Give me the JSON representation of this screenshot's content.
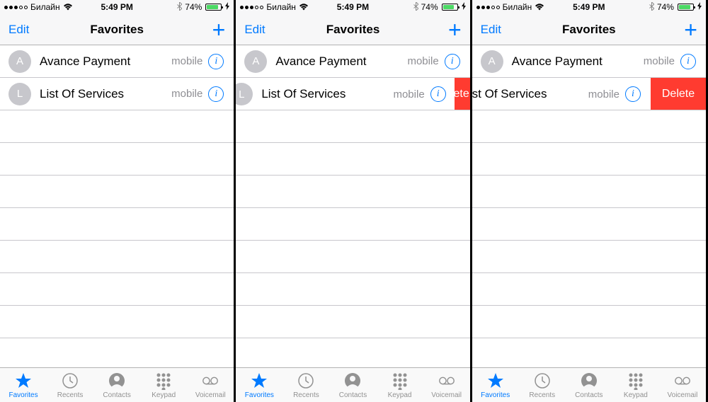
{
  "statusbar": {
    "carrier": "Билайн",
    "time": "5:49 PM",
    "battery_pct": "74%"
  },
  "navbar": {
    "edit": "Edit",
    "title": "Favorites",
    "plus": "+"
  },
  "rows": [
    {
      "initial": "A",
      "name": "Avance Payment",
      "type": "mobile"
    },
    {
      "initial": "L",
      "name": "List Of Services",
      "type": "mobile"
    }
  ],
  "delete_label": "Delete",
  "delete_partial": "ete",
  "tabs": {
    "favorites": "Favorites",
    "recents": "Recents",
    "contacts": "Contacts",
    "keypad": "Keypad",
    "voicemail": "Voicemail"
  },
  "screen3_row1_name_trunc": "st Of Services"
}
